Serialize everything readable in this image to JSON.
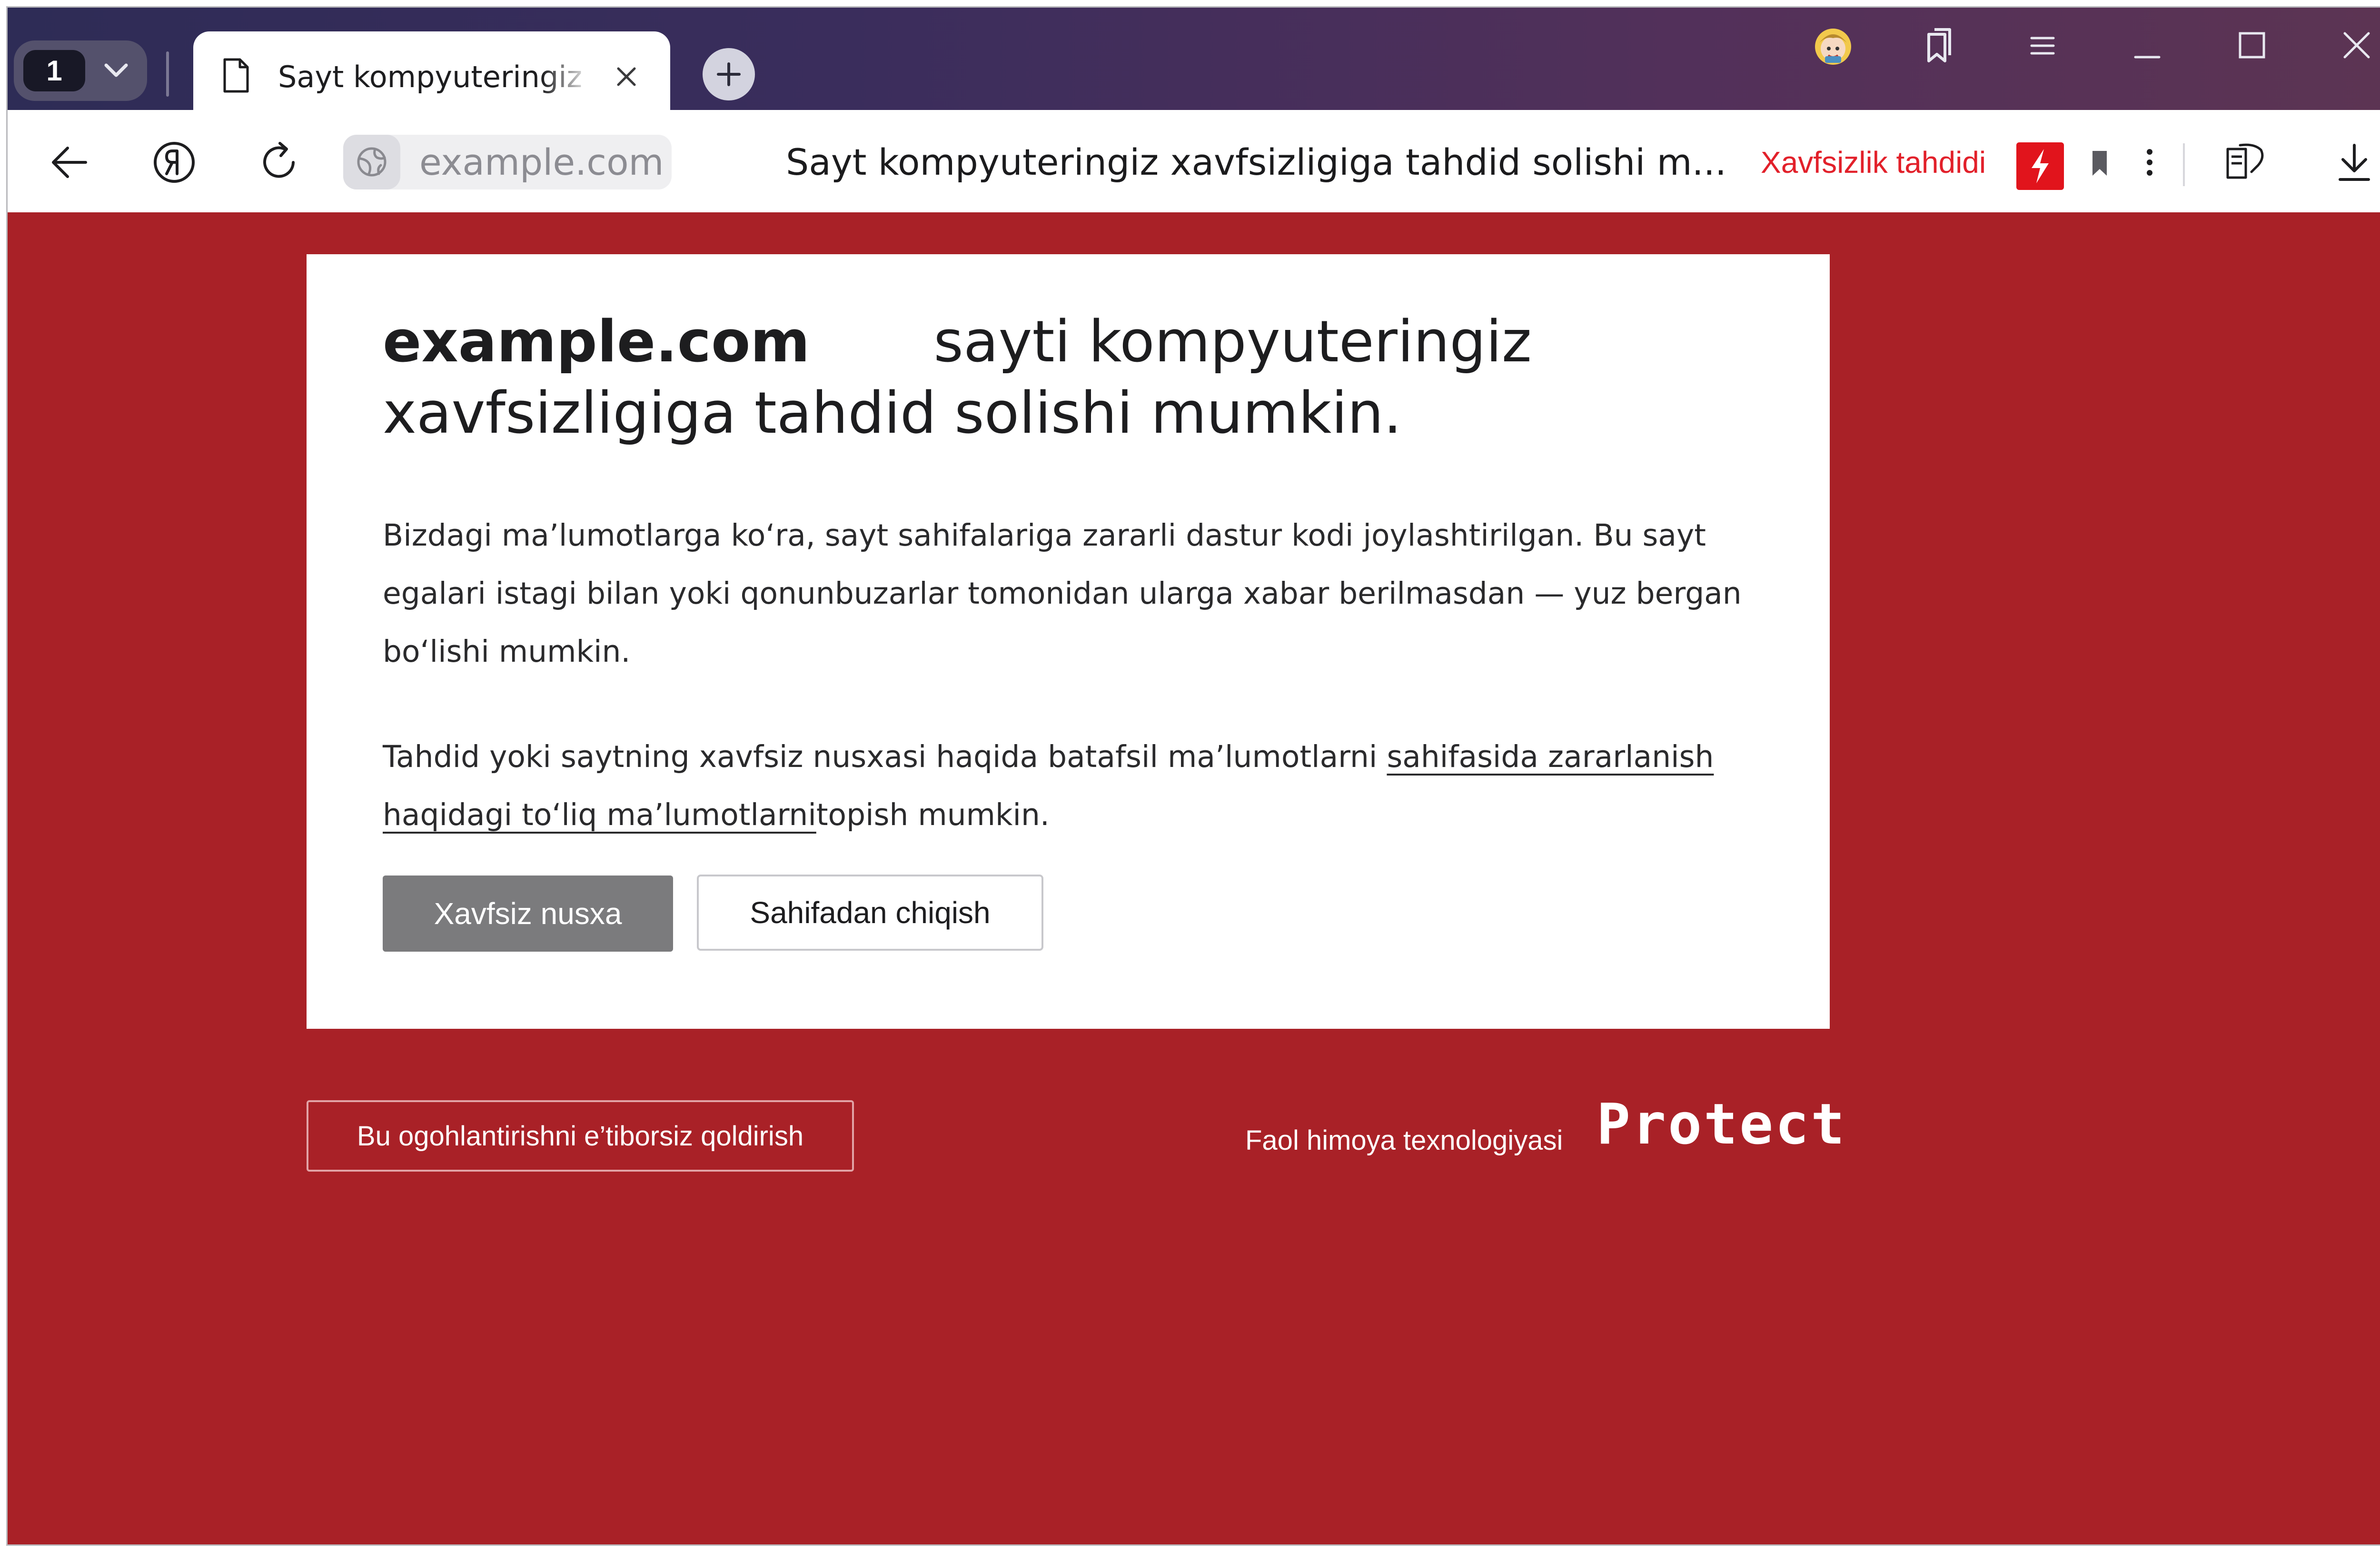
{
  "browser": {
    "tab_count": "1",
    "active_tab_title": "Sayt kompyuteringiz xavfsizligiga tahdid solishi mumkin",
    "address": {
      "host": "example.com",
      "page_title": "Sayt kompyuteringiz xavfsizligiga tahdid solishi m...",
      "threat_label": "Xavfsizlik tahdidi"
    }
  },
  "warning": {
    "domain": "example.com",
    "headline_rest": "sayti kompyuteringiz xavfsizligiga tahdid solishi mumkin.",
    "paragraph1": "Bizdagi ma’lumotlarga ko‘ra, sayt sahifalariga zararli dastur kodi joylashtirilgan. Bu sayt egalari istagi bilan yoki qonunbuzarlar tomonidan ularga xabar berilmasdan — yuz bergan bo‘lishi mumkin.",
    "paragraph2_before": "Tahdid yoki saytning xavfsiz nusxasi haqida batafsil ma’lumotlarni ",
    "paragraph2_link": "sahifasida zararlanish haqidagi to‘liq ma’lumotlarni",
    "paragraph2_after": "topish mumkin.",
    "safe_copy_button": "Xavfsiz nusxa",
    "leave_button": "Sahifadan chiqish"
  },
  "footer": {
    "ignore_button": "Bu ogohlantirishni e’tiborsiz qoldirish",
    "protect_caption": "Faol himoya texnologiyasi",
    "protect_logo": "Protect"
  },
  "colors": {
    "page_background": "#a92127",
    "threat_red": "#e1141c",
    "primary_button": "#7b7b7d"
  }
}
